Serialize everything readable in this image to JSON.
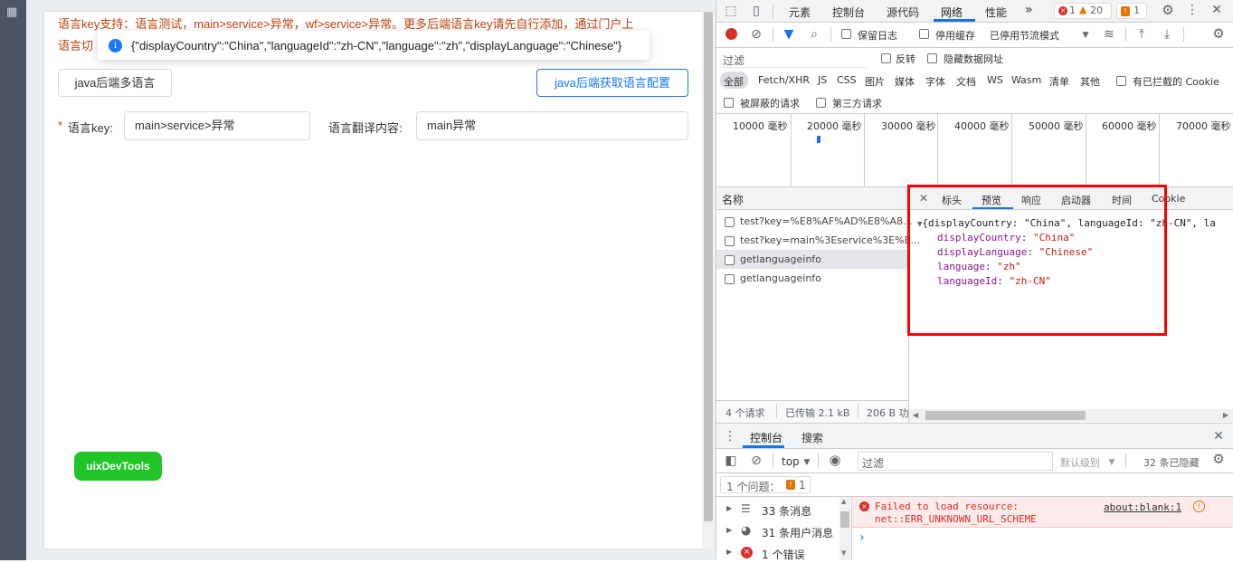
{
  "page": {
    "warn_line1": "语言key支持：语言测试，main>service>异常，wf>service>异常。更多后端语言key请先自行添加，通过门户上",
    "warn_line2": "语言切",
    "toast_message": "{\"displayCountry\":\"China\",\"languageId\":\"zh-CN\",\"language\":\"zh\",\"displayLanguage\":\"Chinese\"}",
    "btn_multi": "java后端多语言",
    "btn_get_config": "java后端获取语言配置",
    "required_mark": "*",
    "key_label": "语言key:",
    "key_value": "main>service>异常",
    "translate_label": "语言翻译内容:",
    "translate_value": "main异常",
    "uix_label": "uixDevTools"
  },
  "devtools": {
    "main_tabs": [
      "元素",
      "控制台",
      "源代码",
      "网络",
      "性能"
    ],
    "active_main_tab": "网络",
    "more_tabs": "»",
    "error_count": "1",
    "warning_count": "20",
    "issue_count": "1",
    "preserve_log": "保留日志",
    "disable_cache": "停用缓存",
    "throttle": "已停用节流模式",
    "filter_placeholder": "过滤",
    "invert": "反转",
    "hide_data_urls": "隐藏数据网址",
    "type_filters": [
      "全部",
      "Fetch/XHR",
      "JS",
      "CSS",
      "图片",
      "媒体",
      "字体",
      "文档",
      "WS",
      "Wasm",
      "清单",
      "其他"
    ],
    "blocked_cookies": "有已拦截的 Cookie",
    "blocked_requests": "被屏蔽的请求",
    "third_party": "第三方请求",
    "timeline_labels": [
      "10000 毫秒",
      "20000 毫秒",
      "30000 毫秒",
      "40000 毫秒",
      "50000 毫秒",
      "60000 毫秒",
      "70000 毫秒"
    ],
    "name_header": "名称",
    "requests": [
      "test?key=%E8%AF%AD%E8%A8...",
      "test?key=main%3Eservice%3E%E...",
      "getlanguageinfo",
      "getlanguageinfo"
    ],
    "detail_tabs": [
      "标头",
      "预览",
      "响应",
      "启动器",
      "时间",
      "Cookie"
    ],
    "active_detail_tab": "预览",
    "preview_summary": "{displayCountry: \"China\", languageId: \"zh-CN\", la",
    "preview_fields": [
      {
        "key": "displayCountry",
        "value": "\"China\""
      },
      {
        "key": "displayLanguage",
        "value": "\"Chinese\""
      },
      {
        "key": "language",
        "value": "\"zh\""
      },
      {
        "key": "languageId",
        "value": "\"zh-CN\""
      }
    ],
    "status_requests": "4 个请求",
    "status_transferred": "已传输 2.1 kB",
    "status_resources": "206 B 功",
    "drawer_tabs": [
      "控制台",
      "搜索"
    ],
    "context": "top",
    "console_filter_placeholder": "过滤",
    "default_levels": "默认级别",
    "hidden_count": "32 条已隐藏",
    "issues_text": "1 个问题：",
    "issues_count": "1",
    "sidebar_items": [
      {
        "label": "33 条消息"
      },
      {
        "label": "31 条用户消息"
      },
      {
        "label": "1 个错误"
      }
    ],
    "error_line1": "Failed to load resource:",
    "error_line2": "net::ERR_UNKNOWN_URL_SCHEME",
    "error_source": "about:blank:1",
    "prompt": "›"
  },
  "colors": {
    "accent": "#1a73e8",
    "error": "#d93025",
    "highlight_box": "#ff0000",
    "uix_green": "#22c527"
  }
}
